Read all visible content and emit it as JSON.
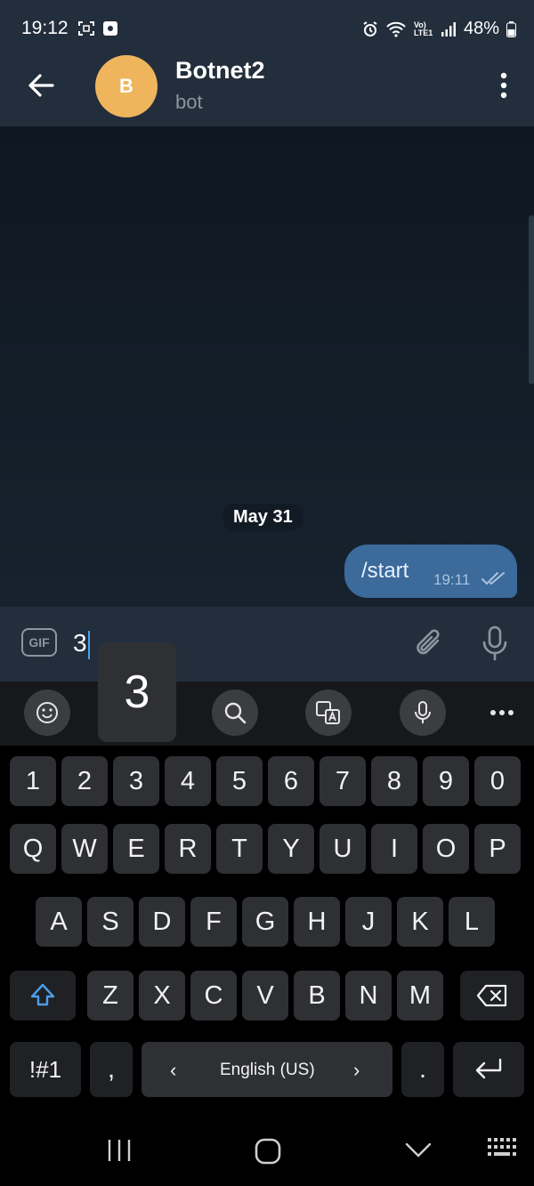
{
  "status_bar": {
    "time": "19:12",
    "battery": "48%",
    "volte": "Vo) LTE1",
    "icons": [
      "screenshot-icon",
      "app-notification-icon",
      "alarm-icon",
      "wifi-icon",
      "volte-icon",
      "signal-icon",
      "battery-icon"
    ]
  },
  "header": {
    "avatar_letter": "B",
    "avatar_color": "#eeb55d",
    "title": "Botnet2",
    "subtitle": "bot"
  },
  "chat": {
    "date_label": "May 31",
    "messages": [
      {
        "text": "/start",
        "time": "19:11",
        "status": "read"
      }
    ]
  },
  "input": {
    "gif_label": "GIF",
    "value": "3"
  },
  "keyboard": {
    "key_preview": "3",
    "number_row": [
      "1",
      "2",
      "3",
      "4",
      "5",
      "6",
      "7",
      "8",
      "9",
      "0"
    ],
    "row1": [
      "Q",
      "W",
      "E",
      "R",
      "T",
      "Y",
      "U",
      "I",
      "O",
      "P"
    ],
    "row2": [
      "A",
      "S",
      "D",
      "F",
      "G",
      "H",
      "J",
      "K",
      "L"
    ],
    "row3": [
      "Z",
      "X",
      "C",
      "V",
      "B",
      "N",
      "M"
    ],
    "symbols_label": "!#1",
    "comma": ",",
    "period": ".",
    "language_label": "English (US)",
    "lang_prev": "‹",
    "lang_next": "›"
  },
  "colors": {
    "header_bg": "#232e3c",
    "bubble_bg": "#3b6a9b",
    "shift_accent": "#4d9ee8"
  }
}
